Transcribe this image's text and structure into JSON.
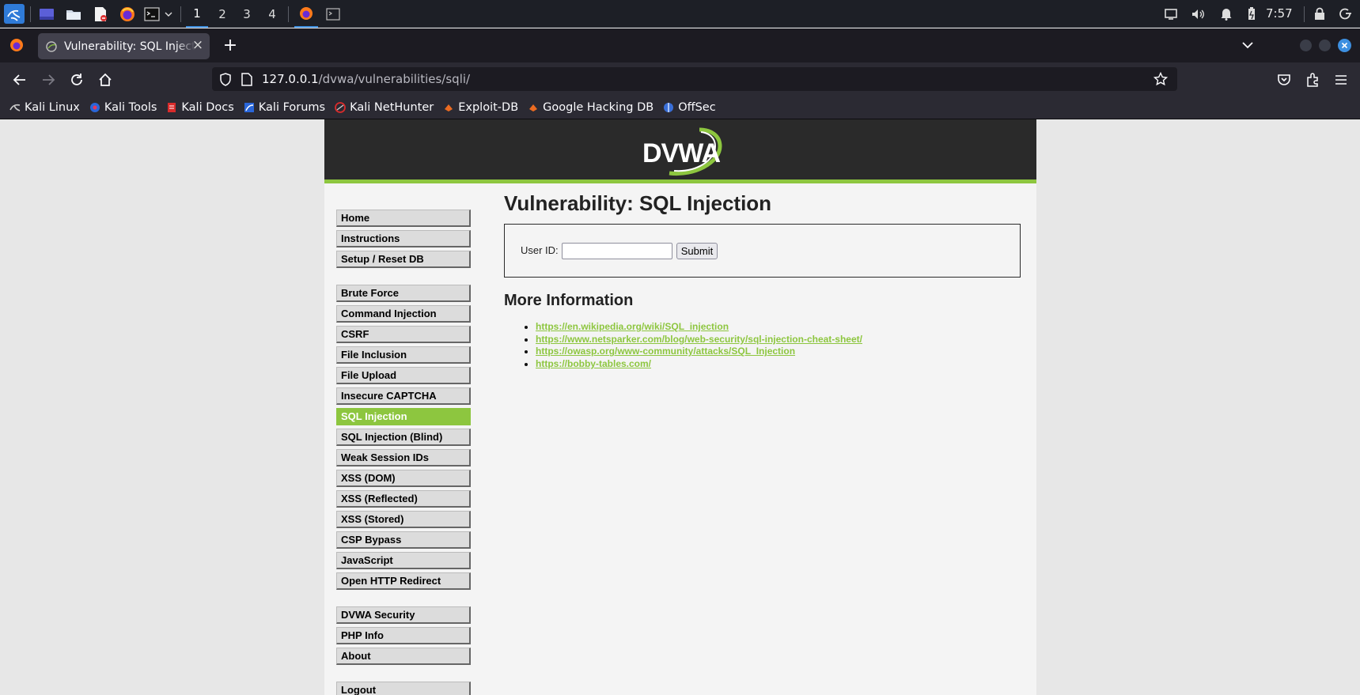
{
  "panel": {
    "workspaces": [
      "1",
      "2",
      "3",
      "4"
    ],
    "active_workspace": "1",
    "clock": "7:57"
  },
  "browser": {
    "tab_title": "Vulnerability: SQL Injection",
    "url_host": "127.0.0.1",
    "url_path": "/dvwa/vulnerabilities/sqli/",
    "bookmarks": [
      {
        "label": "Kali Linux",
        "icon": "kali-dragon-icon"
      },
      {
        "label": "Kali Tools",
        "icon": "kali-tools-icon"
      },
      {
        "label": "Kali Docs",
        "icon": "kali-docs-icon"
      },
      {
        "label": "Kali Forums",
        "icon": "kali-forums-icon"
      },
      {
        "label": "Kali NetHunter",
        "icon": "nethunter-icon"
      },
      {
        "label": "Exploit-DB",
        "icon": "exploit-db-icon"
      },
      {
        "label": "Google Hacking DB",
        "icon": "ghdb-icon"
      },
      {
        "label": "OffSec",
        "icon": "offsec-icon"
      }
    ]
  },
  "page": {
    "logo_text": "DVWA",
    "title": "Vulnerability: SQL Injection",
    "form": {
      "user_id_label": "User ID:",
      "user_id_value": "",
      "submit_label": "Submit"
    },
    "more_info_heading": "More Information",
    "links": [
      "https://en.wikipedia.org/wiki/SQL_injection",
      "https://www.netsparker.com/blog/web-security/sql-injection-cheat-sheet/",
      "https://owasp.org/www-community/attacks/SQL_Injection",
      "https://bobby-tables.com/"
    ],
    "menu_groups": [
      [
        "Home",
        "Instructions",
        "Setup / Reset DB"
      ],
      [
        "Brute Force",
        "Command Injection",
        "CSRF",
        "File Inclusion",
        "File Upload",
        "Insecure CAPTCHA",
        "SQL Injection",
        "SQL Injection (Blind)",
        "Weak Session IDs",
        "XSS (DOM)",
        "XSS (Reflected)",
        "XSS (Stored)",
        "CSP Bypass",
        "JavaScript",
        "Open HTTP Redirect"
      ],
      [
        "DVWA Security",
        "PHP Info",
        "About"
      ],
      [
        "Logout"
      ]
    ],
    "selected_menu_item": "SQL Injection",
    "accent_color": "#8dc63f"
  }
}
